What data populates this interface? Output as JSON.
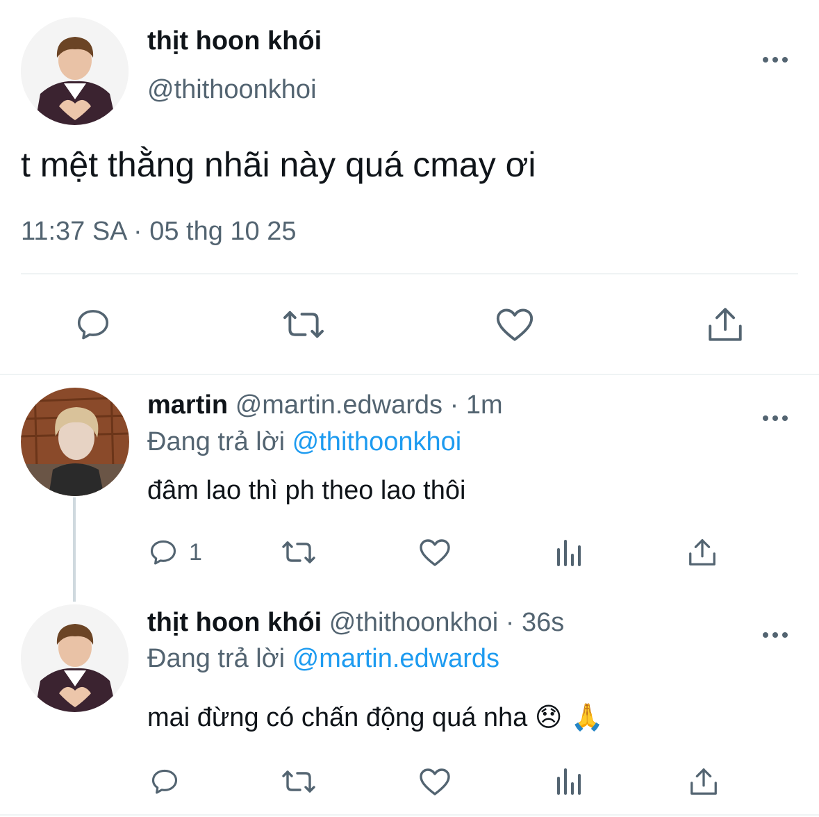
{
  "main_tweet": {
    "display_name": "thịt hoon khói",
    "handle": "@thithoonkhoi",
    "text": "t mệt thằng nhãi này quá cmay ơi",
    "timestamp": "11:37 SA · 05 thg 10 25",
    "more_icon": "more-dots-icon",
    "actions": [
      "reply-icon",
      "retweet-icon",
      "like-icon",
      "share-icon"
    ]
  },
  "reply1": {
    "display_name": "martin",
    "handle": "@martin.edwards",
    "time": "· 1m",
    "replying_prefix": "Đang trả lời",
    "replying_to": "@thithoonkhoi",
    "text": "đâm lao thì ph theo lao thôi",
    "reply_count": "1",
    "actions": [
      "reply-icon",
      "retweet-icon",
      "like-icon",
      "analytics-icon",
      "share-icon"
    ]
  },
  "reply2": {
    "display_name": "thịt hoon khói",
    "handle": "@thithoonkhoi",
    "time": "· 36s",
    "replying_prefix": "Đang trả lời",
    "replying_to": "@martin.edwards",
    "text": "mai đừng có chấn động quá nha",
    "emoji": "😞 🙏",
    "actions": [
      "reply-icon",
      "retweet-icon",
      "like-icon",
      "analytics-icon",
      "share-icon"
    ]
  },
  "colors": {
    "text": "#0f1419",
    "secondary": "#536471",
    "link": "#1d9bf0",
    "divider": "#eff3f4"
  }
}
